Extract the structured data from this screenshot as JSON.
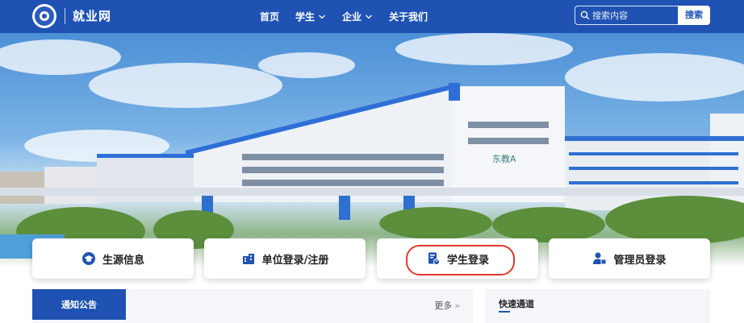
{
  "header": {
    "site_name": "就业网",
    "nav": [
      {
        "label": "首页",
        "has_dropdown": false
      },
      {
        "label": "学生",
        "has_dropdown": true
      },
      {
        "label": "企业",
        "has_dropdown": true
      },
      {
        "label": "关于我们",
        "has_dropdown": false
      }
    ],
    "search": {
      "placeholder": "搜索内容",
      "button": "搜索"
    }
  },
  "banner": {
    "building_sign": "东教A"
  },
  "quick_cards": [
    {
      "label": "生源信息",
      "icon": "graduation-cap-icon"
    },
    {
      "label": "单位登录/注册",
      "icon": "company-building-icon"
    },
    {
      "label": "学生登录",
      "icon": "student-id-icon",
      "highlighted": true
    },
    {
      "label": "管理员登录",
      "icon": "admin-user-icon"
    }
  ],
  "notice": {
    "tab": "通知公告",
    "more": "更多"
  },
  "quick_links": {
    "title": "快速通道"
  },
  "colors": {
    "brand": "#1f52b3",
    "highlight": "#e0392b"
  }
}
